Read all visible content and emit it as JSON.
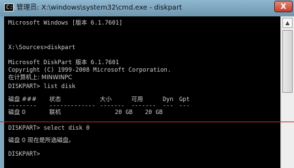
{
  "window": {
    "title": "管理员: X:\\windows\\system32\\cmd.exe - diskpart",
    "icon": "cmd-icon",
    "close_label": "X"
  },
  "console": {
    "lines": [
      "Microsoft Windows [版本 6.1.7601]",
      "",
      "",
      "X:\\Sources>diskpart",
      "",
      "Microsoft DiskPart 版本 6.1.7601",
      "Copyright (C) 1999-2008 Microsoft Corporation.",
      "在计算机上: MINWINPC",
      "",
      "DISKPART> list disk",
      "",
      "",
      "",
      "",
      "DISKPART> select disk 0",
      "",
      "磁盘 0 现在是所选磁盘。",
      "",
      "DISKPART>"
    ],
    "table": {
      "headers": [
        "磁盘 ###",
        "状态",
        "大小",
        "可用",
        "Dyn",
        "Gpt"
      ],
      "separators": [
        "--------",
        "-------------",
        "-------",
        "-------",
        "---",
        "---"
      ],
      "rows": [
        [
          "磁盘 0",
          "联机",
          "20 GB",
          "20 GB",
          "",
          ""
        ]
      ]
    }
  }
}
